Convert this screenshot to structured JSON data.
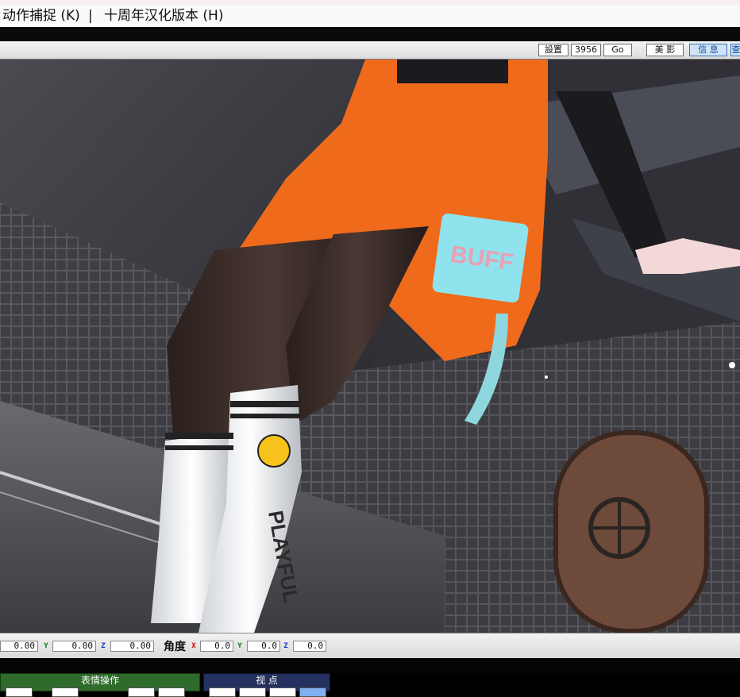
{
  "menubar": {
    "motion_capture": "动作捕捉 (K)",
    "separator": "|",
    "version": "十周年汉化版本 (H)"
  },
  "toolbar": {
    "settings": "設置",
    "frame_value": "3956",
    "go": "Go",
    "beautify": "美 影",
    "info": "信 息",
    "extra": "查"
  },
  "coords": {
    "pos_x_value": "0.00",
    "y_axis": "Y",
    "pos_y_value": "0.00",
    "z_axis": "Z",
    "pos_z_value": "0.00",
    "angle_label": "角度",
    "x_axis": "X",
    "ang_x_value": "0.0",
    "ang_y_value": "0.0",
    "ang_z_value": "0.0"
  },
  "panels": {
    "expression_title": "表情操作",
    "view_title": "视 点"
  },
  "viewport_scene": {
    "bag_text": "BUFF",
    "sock_text": "PLAYFUL"
  },
  "colors": {
    "accent_blue": "#0a4aa0",
    "jacket_orange": "#f06a1c",
    "expression_panel": "#2f6b2a",
    "view_panel": "#24305e"
  }
}
